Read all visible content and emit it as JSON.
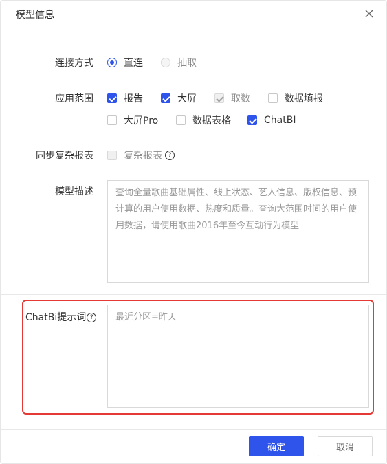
{
  "dialog": {
    "title": "模型信息",
    "close_icon": "close-icon"
  },
  "connection": {
    "label": "连接方式",
    "options": [
      {
        "label": "直连",
        "selected": true,
        "disabled": false
      },
      {
        "label": "抽取",
        "selected": false,
        "disabled": true
      }
    ]
  },
  "scope": {
    "label": "应用范围",
    "options": [
      {
        "label": "报告",
        "checked": true,
        "disabled": false
      },
      {
        "label": "大屏",
        "checked": true,
        "disabled": false
      },
      {
        "label": "取数",
        "checked": true,
        "disabled": true
      },
      {
        "label": "数据填报",
        "checked": false,
        "disabled": false
      },
      {
        "label": "大屏Pro",
        "checked": false,
        "disabled": false
      },
      {
        "label": "数据表格",
        "checked": false,
        "disabled": false
      },
      {
        "label": "ChatBI",
        "checked": true,
        "disabled": false
      }
    ]
  },
  "sync": {
    "label": "同步复杂报表",
    "option_label": "复杂报表",
    "checked": false,
    "disabled": true,
    "help_icon": "question-circle-icon"
  },
  "description": {
    "label": "模型描述",
    "placeholder": "查询全量歌曲基础属性、线上状态、艺人信息、版权信息、预计算的用户使用数据、热度和质量。查询大范围时间的用户使用数据，请使用歌曲2016年至今互动行为模型"
  },
  "chatbi_prompt": {
    "label": "ChatBi提示词",
    "help_icon": "question-circle-icon",
    "placeholder": "最近分区=昨天"
  },
  "footer": {
    "confirm_label": "确定",
    "cancel_label": "取消"
  },
  "colors": {
    "primary": "#2f54eb",
    "highlight": "#e53935"
  }
}
